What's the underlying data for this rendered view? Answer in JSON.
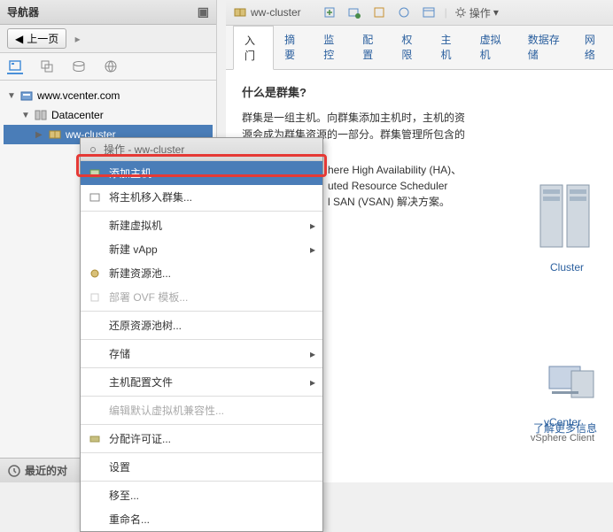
{
  "nav": {
    "title": "导航器",
    "back": "上一页",
    "tree": {
      "root": "www.vcenter.com",
      "datacenter": "Datacenter",
      "cluster": "ww-cluster"
    }
  },
  "recent": {
    "title": "最近的对"
  },
  "crumb": {
    "cluster": "ww-cluster"
  },
  "actions_label": "操作",
  "tabs": {
    "t0": "入门",
    "t1": "摘要",
    "t2": "监控",
    "t3": "配置",
    "t4": "权限",
    "t5": "主机",
    "t6": "虚拟机",
    "t7": "数据存储",
    "t8": "网络"
  },
  "content": {
    "heading": "什么是群集?",
    "p1": "群集是一组主机。向群集添加主机时，主机的资源会成为群集资源的一部分。群集管理所包含的所有主机的资源。",
    "extra1": "here High Availability (HA)、",
    "extra2": "uted Resource Scheduler",
    "extra3": "l SAN (VSAN) 解决方案。"
  },
  "diagram": {
    "cluster": "Cluster",
    "vcenter": "vCenter",
    "client": "vSphere Client"
  },
  "learn_more": "了解更多信息",
  "menu": {
    "header": "操作 - ww-cluster",
    "m0": "添加主机...",
    "m1": "将主机移入群集...",
    "m2": "新建虚拟机",
    "m3": "新建 vApp",
    "m4": "新建资源池...",
    "m5": "部署 OVF 模板...",
    "m6": "还原资源池树...",
    "m7": "存储",
    "m8": "主机配置文件",
    "m9": "编辑默认虚拟机兼容性...",
    "m10": "分配许可证...",
    "m11": "设置",
    "m12": "移至...",
    "m13": "重命名..."
  }
}
